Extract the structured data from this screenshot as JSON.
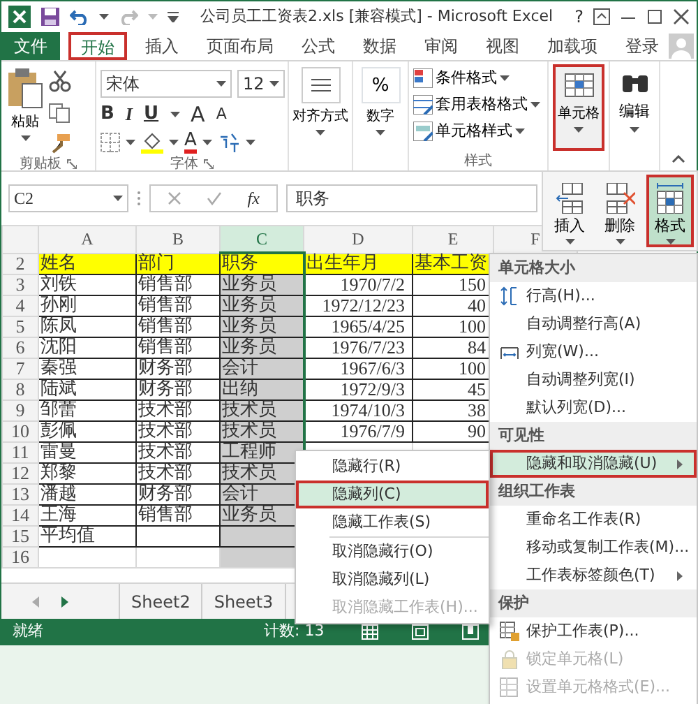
{
  "window": {
    "title": "公司员工工资表2.xls  [兼容模式] - Microsoft Excel",
    "help": "?"
  },
  "ribbon_tabs": [
    {
      "label": "文件",
      "kind": "file",
      "selected": false
    },
    {
      "label": "开始",
      "kind": "tab",
      "selected": true
    },
    {
      "label": "插入",
      "kind": "tab",
      "selected": false
    },
    {
      "label": "页面布局",
      "kind": "tab",
      "selected": false
    },
    {
      "label": "公式",
      "kind": "tab",
      "selected": false
    },
    {
      "label": "数据",
      "kind": "tab",
      "selected": false
    },
    {
      "label": "审阅",
      "kind": "tab",
      "selected": false
    },
    {
      "label": "视图",
      "kind": "tab",
      "selected": false
    },
    {
      "label": "加载项",
      "kind": "tab",
      "selected": false
    },
    {
      "label": "登录",
      "kind": "account",
      "selected": false
    }
  ],
  "clipboard": {
    "paste": "粘贴",
    "caption": "剪贴板"
  },
  "font": {
    "name": "宋体",
    "size": "12",
    "bold": "B",
    "italic": "I",
    "underline": "U",
    "grow": "A",
    "shrink": "A",
    "color_button": "A",
    "caption": "字体"
  },
  "alignment": {
    "label": "对齐方式"
  },
  "number": {
    "symbol": "%",
    "label": "数字"
  },
  "styles": {
    "items": [
      "条件格式",
      "套用表格格式",
      "单元格样式"
    ],
    "caption": "样式"
  },
  "cells_button": {
    "label": "单元格",
    "pressed": true
  },
  "editing": {
    "label": "编辑"
  },
  "formula_bar": {
    "name_box": "C2",
    "fx": "fx",
    "formula": "职务"
  },
  "cells_panel": [
    {
      "label": "插入",
      "selected": false
    },
    {
      "label": "删除",
      "selected": false
    },
    {
      "label": "格式",
      "selected": true
    }
  ],
  "sheet": {
    "columns": [
      {
        "label": "A",
        "selected": false
      },
      {
        "label": "B",
        "selected": false
      },
      {
        "label": "C",
        "selected": true
      },
      {
        "label": "D",
        "selected": false
      },
      {
        "label": "E",
        "selected": false
      },
      {
        "label": "F",
        "selected": false
      }
    ],
    "rows": [
      {
        "number": "2",
        "kind": "heading",
        "cells": [
          "姓名",
          "部门",
          "职务",
          "出生年月",
          "基本工资"
        ]
      },
      {
        "number": "3",
        "kind": "data",
        "cells": [
          "刘铁",
          "销售部",
          "业务员",
          "1970/7/2",
          "150"
        ]
      },
      {
        "number": "4",
        "kind": "data",
        "cells": [
          "孙刚",
          "销售部",
          "业务员",
          "1972/12/23",
          "40"
        ]
      },
      {
        "number": "5",
        "kind": "data",
        "cells": [
          "陈凤",
          "销售部",
          "业务员",
          "1965/4/25",
          "100"
        ]
      },
      {
        "number": "6",
        "kind": "data",
        "cells": [
          "沈阳",
          "销售部",
          "业务员",
          "1976/7/23",
          "84"
        ]
      },
      {
        "number": "7",
        "kind": "data",
        "cells": [
          "秦强",
          "财务部",
          "会计",
          "1967/6/3",
          "100"
        ]
      },
      {
        "number": "8",
        "kind": "data",
        "cells": [
          "陆斌",
          "财务部",
          "出纳",
          "1972/9/3",
          "45"
        ]
      },
      {
        "number": "9",
        "kind": "data",
        "cells": [
          "邹蕾",
          "技术部",
          "技术员",
          "1974/10/3",
          "38"
        ]
      },
      {
        "number": "10",
        "kind": "data",
        "cells": [
          "彭佩",
          "技术部",
          "技术员",
          "1976/7/9",
          "90"
        ]
      },
      {
        "number": "11",
        "kind": "data",
        "cells": [
          "雷曼",
          "技术部",
          "工程师"
        ]
      },
      {
        "number": "12",
        "kind": "data",
        "cells": [
          "郑黎",
          "技术部",
          "技术员"
        ]
      },
      {
        "number": "13",
        "kind": "data",
        "cells": [
          "潘越",
          "财务部",
          "会计"
        ]
      },
      {
        "number": "14",
        "kind": "data",
        "cells": [
          "王海",
          "销售部",
          "业务员"
        ]
      },
      {
        "number": "15",
        "kind": "data",
        "cells": [
          "平均值"
        ]
      },
      {
        "number": "16",
        "kind": "blank"
      }
    ]
  },
  "sheet_tabs": [
    {
      "label": "Sheet2",
      "selected": false
    },
    {
      "label": "Sheet3",
      "selected": false
    }
  ],
  "status_bar": {
    "state": "就绪",
    "count": "计数: 13"
  },
  "format_menu": [
    {
      "kind": "heading",
      "label": "单元格大小"
    },
    {
      "kind": "item",
      "label": "行高(H)...",
      "selected": false,
      "disabled": false
    },
    {
      "kind": "item",
      "label": "自动调整行高(A)",
      "selected": false,
      "disabled": false
    },
    {
      "kind": "item",
      "label": "列宽(W)...",
      "selected": false,
      "disabled": false
    },
    {
      "kind": "item",
      "label": "自动调整列宽(I)",
      "selected": false,
      "disabled": false
    },
    {
      "kind": "item",
      "label": "默认列宽(D)...",
      "selected": false,
      "disabled": false
    },
    {
      "kind": "heading",
      "label": "可见性"
    },
    {
      "kind": "submenu",
      "label": "隐藏和取消隐藏(U)",
      "selected": true,
      "disabled": false
    },
    {
      "kind": "heading",
      "label": "组织工作表"
    },
    {
      "kind": "item",
      "label": "重命名工作表(R)",
      "selected": false,
      "disabled": false
    },
    {
      "kind": "item",
      "label": "移动或复制工作表(M)...",
      "selected": false,
      "disabled": false
    },
    {
      "kind": "submenu",
      "label": "工作表标签颜色(T)",
      "selected": false,
      "disabled": false
    },
    {
      "kind": "heading",
      "label": "保护"
    },
    {
      "kind": "item",
      "label": "保护工作表(P)...",
      "selected": false,
      "disabled": false
    },
    {
      "kind": "item",
      "label": "锁定单元格(L)",
      "selected": false,
      "disabled": true
    },
    {
      "kind": "item",
      "label": "设置单元格格式(E)...",
      "selected": false,
      "disabled": true
    }
  ],
  "hide_submenu": [
    {
      "label": "隐藏行(R)",
      "selected": false,
      "disabled": false
    },
    {
      "label": "隐藏列(C)",
      "selected": true,
      "disabled": false
    },
    {
      "label": "隐藏工作表(S)",
      "selected": false,
      "disabled": false
    },
    {
      "label": "取消隐藏行(O)",
      "selected": false,
      "disabled": false
    },
    {
      "label": "取消隐藏列(L)",
      "selected": false,
      "disabled": false
    },
    {
      "label": "取消隐藏工作表(H)...",
      "selected": false,
      "disabled": true
    }
  ]
}
